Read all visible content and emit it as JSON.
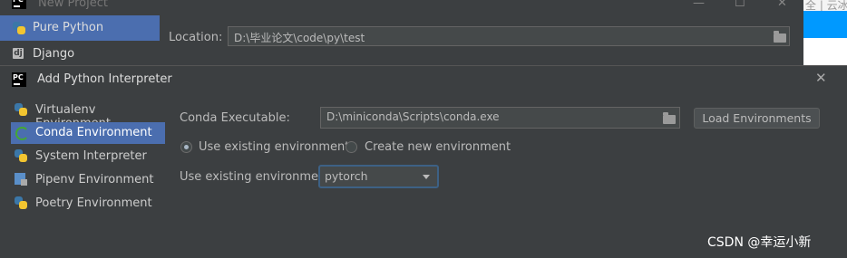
{
  "background_page": {
    "top_text": "全 | 云冰"
  },
  "new_project": {
    "title": "New Project",
    "window_buttons": [
      "—",
      "☐",
      "✕"
    ],
    "sidebar": [
      {
        "label": "Pure Python",
        "icon": "python-icon",
        "selected": true
      },
      {
        "label": "Django",
        "icon": "django-icon",
        "selected": false
      }
    ],
    "location_label": "Location:",
    "location_value": "D:\\毕业论文\\code\\py\\test"
  },
  "dialog": {
    "title": "Add Python Interpreter",
    "close": "✕",
    "sidebar": [
      {
        "label": "Virtualenv Environment",
        "icon": "python-icon",
        "selected": false
      },
      {
        "label": "Conda Environment",
        "icon": "conda-icon",
        "selected": true
      },
      {
        "label": "System Interpreter",
        "icon": "python-icon",
        "selected": false
      },
      {
        "label": "Pipenv Environment",
        "icon": "pipenv-icon",
        "selected": false
      },
      {
        "label": "Poetry Environment",
        "icon": "python-icon",
        "selected": false
      }
    ],
    "conda_executable_label": "Conda Executable:",
    "conda_executable_value": "D:\\miniconda\\Scripts\\conda.exe",
    "load_button": "Load Environments",
    "radio_existing": "Use existing environment",
    "radio_new": "Create new environment",
    "selected_radio": "existing",
    "existing_env_label": "Use existing environment:",
    "existing_env_value": "pytorch"
  },
  "watermark": "CSDN @幸运小新",
  "colors": {
    "accent": "#4b6eaf",
    "background": "#3c3f41",
    "field": "#45494a"
  }
}
